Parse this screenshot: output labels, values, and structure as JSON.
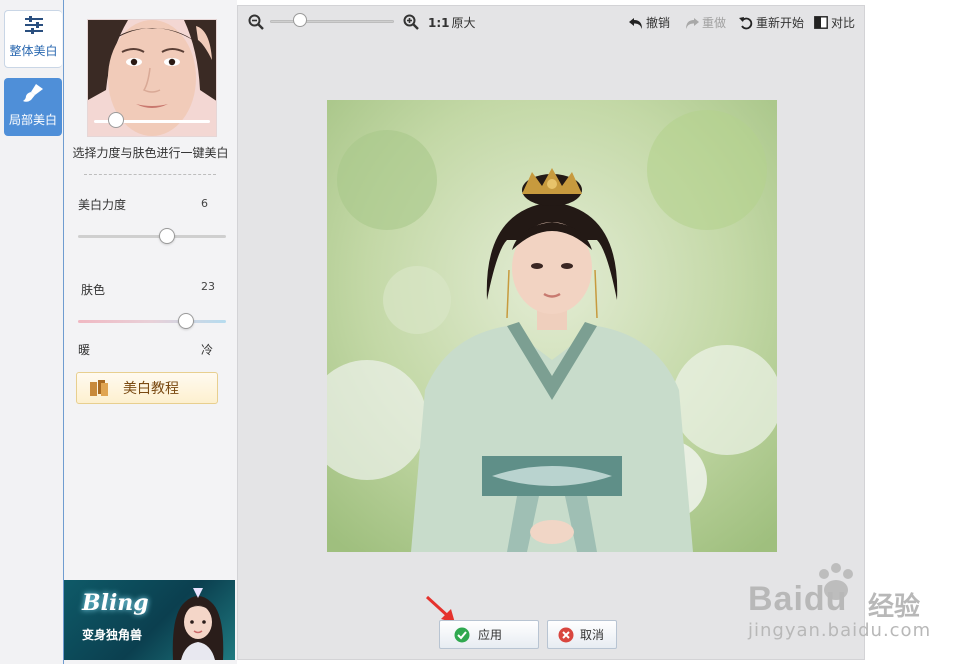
{
  "rail": {
    "tab_overall": "整体美白",
    "tab_local": "局部美白"
  },
  "panel": {
    "description": "选择力度与肤色进行一键美白",
    "strength_label": "美白力度",
    "strength_value": "6",
    "strength_level": 0.6,
    "tone_label": "肤色",
    "tone_value": "23",
    "tone_level": 0.73,
    "warm_label": "暖",
    "cool_label": "冷",
    "tutorial_button": "美白教程",
    "ad": {
      "title": "Bling",
      "subtitle": "变身独角兽"
    }
  },
  "toolbar": {
    "ratio_label": "1:1",
    "original_label": "原大",
    "undo": "撤销",
    "redo": "重做",
    "restart": "重新开始",
    "compare": "对比"
  },
  "actions": {
    "apply": "应用",
    "cancel": "取消"
  },
  "watermark": {
    "brand": "Baidu",
    "brand_cn": "经验",
    "url": "jingyan.baidu.com"
  },
  "colors": {
    "accent": "#4f8fd8",
    "apply_icon": "#2fa84f",
    "cancel_icon": "#d9463e",
    "arrow": "#e5322d"
  }
}
